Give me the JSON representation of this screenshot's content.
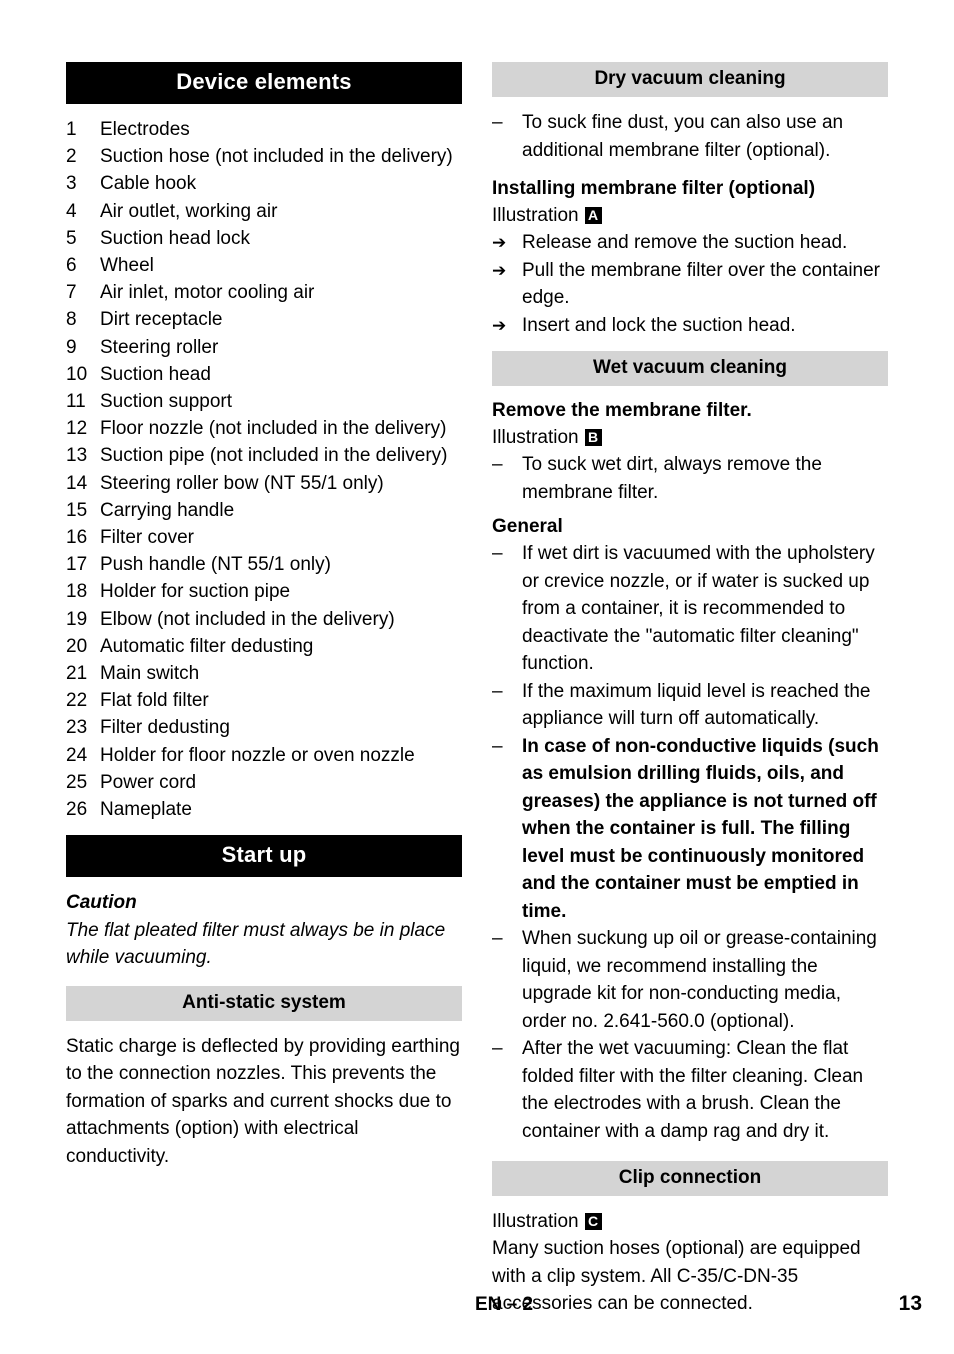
{
  "left_column": {
    "device_elements": {
      "title": "Device elements",
      "items": [
        {
          "n": "1",
          "text": "Electrodes"
        },
        {
          "n": "2",
          "text": "Suction hose (not included in the delivery)"
        },
        {
          "n": "3",
          "text": "Cable hook"
        },
        {
          "n": "4",
          "text": "Air outlet, working air"
        },
        {
          "n": "5",
          "text": "Suction head lock"
        },
        {
          "n": "6",
          "text": "Wheel"
        },
        {
          "n": "7",
          "text": "Air inlet, motor cooling air"
        },
        {
          "n": "8",
          "text": "Dirt receptacle"
        },
        {
          "n": "9",
          "text": "Steering roller"
        },
        {
          "n": "10",
          "text": "Suction head"
        },
        {
          "n": "11",
          "text": "Suction support"
        },
        {
          "n": "12",
          "text": "Floor nozzle (not included in the delivery)"
        },
        {
          "n": "13",
          "text": "Suction pipe (not included in the delivery)"
        },
        {
          "n": "14",
          "text": "Steering roller bow (NT 55/1 only)"
        },
        {
          "n": "15",
          "text": "Carrying handle"
        },
        {
          "n": "16",
          "text": "Filter cover"
        },
        {
          "n": "17",
          "text": "Push handle (NT 55/1 only)"
        },
        {
          "n": "18",
          "text": "Holder for suction pipe"
        },
        {
          "n": "19",
          "text": "Elbow (not included in the delivery)"
        },
        {
          "n": "20",
          "text": "Automatic filter dedusting"
        },
        {
          "n": "21",
          "text": "Main switch"
        },
        {
          "n": "22",
          "text": "Flat fold filter"
        },
        {
          "n": "23",
          "text": "Filter dedusting"
        },
        {
          "n": "24",
          "text": "Holder for floor nozzle or oven nozzle"
        },
        {
          "n": "25",
          "text": "Power cord"
        },
        {
          "n": "26",
          "text": "Nameplate"
        }
      ]
    },
    "start_up": {
      "title": "Start up",
      "caution_label": "Caution",
      "caution_text": "The flat pleated filter must always be in place while vacuuming."
    },
    "anti_static": {
      "title": "Anti-static system",
      "body": "Static charge is deflected by providing earthing to the connection nozzles. This prevents the formation of sparks and current shocks due to attachments (option) with electrical conductivity."
    }
  },
  "right_column": {
    "dry_vacuum": {
      "title": "Dry vacuum cleaning",
      "intro_dash": "To suck fine dust, you can also use an additional membrane filter (optional).",
      "sub_head": "Installing membrane filter (optional)",
      "illustration_label": "Illustration",
      "illustration_ref": "A",
      "steps": [
        "Release and remove the suction head.",
        "Pull the membrane filter over the container edge.",
        "Insert and lock the suction head."
      ]
    },
    "wet_vacuum": {
      "title": "Wet vacuum cleaning",
      "sub_head": "Remove the membrane filter.",
      "illustration_label": "Illustration",
      "illustration_ref": "B",
      "first_dash": "To suck wet dirt, always remove the membrane filter.",
      "general_head": "General",
      "general_items": [
        {
          "text": "If wet dirt is vacuumed with the upholstery or crevice nozzle, or if water is sucked up from a container, it is recommended to deactivate the \"automatic filter cleaning\" function.",
          "bold": false
        },
        {
          "text": "If the maximum liquid level is reached the appliance will turn off automatically.",
          "bold": false
        },
        {
          "text": "In case of non-conductive liquids (such as emulsion drilling fluids, oils, and greases) the appliance is not turned off when the container is full. The filling level must be continuously monitored and the container must be emptied in time.",
          "bold": true
        },
        {
          "text": "When suckung up oil or grease-containing liquid, we recommend installing the upgrade kit for non-conducting media, order no.  2.641-560.0 (optional).",
          "bold": false
        },
        {
          "text": "After the wet vacuuming: Clean the flat folded filter with the filter cleaning. Clean the electrodes with a brush. Clean the container with a damp rag and dry it.",
          "bold": false
        }
      ]
    },
    "clip_connection": {
      "title": "Clip connection",
      "illustration_label": "Illustration",
      "illustration_ref": "C",
      "body": "Many suction hoses (optional) are equipped with a clip system. All C-35/C-DN-35 accessories can be connected."
    }
  },
  "footer": {
    "center": "EN – 2",
    "page_number": "13"
  },
  "symbols": {
    "dash": "–",
    "arrow": "➔"
  }
}
